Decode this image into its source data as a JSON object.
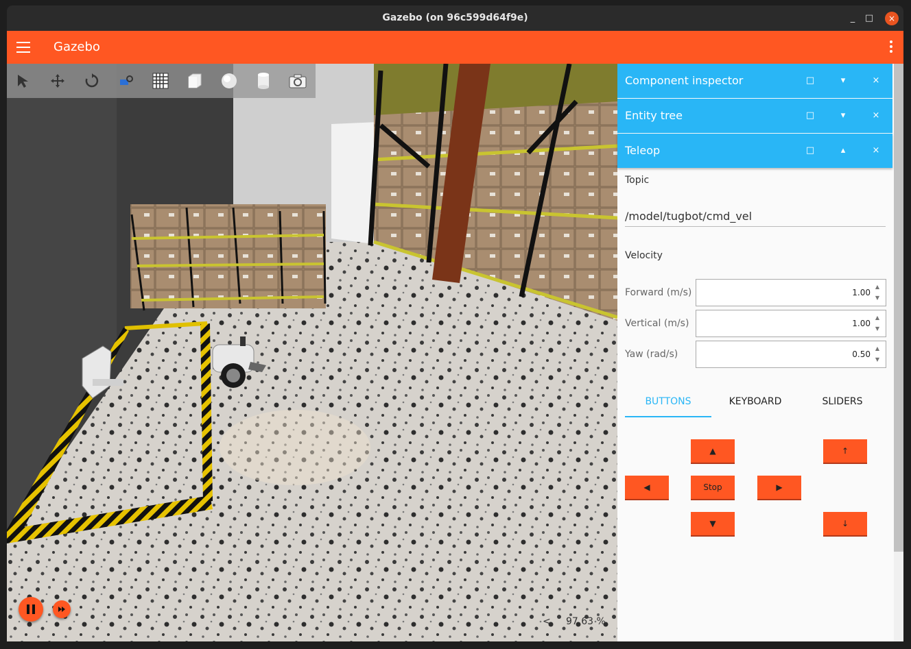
{
  "window": {
    "title": "Gazebo (on 96c599d64f9e)"
  },
  "appbar": {
    "title": "Gazebo"
  },
  "toolbar": {
    "tools": [
      "select-icon",
      "translate-icon",
      "rotate-icon",
      "transform-control-icon",
      "grid-snap-icon",
      "box-icon",
      "sphere-icon",
      "cylinder-icon",
      "camera-icon"
    ]
  },
  "playback": {
    "real_time_factor": "97.63 %",
    "expand": "<"
  },
  "panels": {
    "component_inspector": "Component inspector",
    "entity_tree": "Entity tree",
    "teleop": "Teleop",
    "icons": {
      "maximize": "□",
      "collapse": "▾",
      "expand": "▴",
      "close": "×"
    }
  },
  "teleop": {
    "topic_label": "Topic",
    "topic_value": "/model/tugbot/cmd_vel",
    "velocity_label": "Velocity",
    "forward_label": "Forward (m/s)",
    "forward_value": "1.00",
    "vertical_label": "Vertical (m/s)",
    "vertical_value": "1.00",
    "yaw_label": "Yaw (rad/s)",
    "yaw_value": "0.50",
    "tabs": [
      "BUTTONS",
      "KEYBOARD",
      "SLIDERS"
    ],
    "active_tab": "BUTTONS",
    "buttons": {
      "forward": "▲",
      "backward": "▼",
      "left": "◀",
      "right": "▶",
      "stop": "Stop",
      "up": "↑",
      "down": "↓"
    }
  }
}
